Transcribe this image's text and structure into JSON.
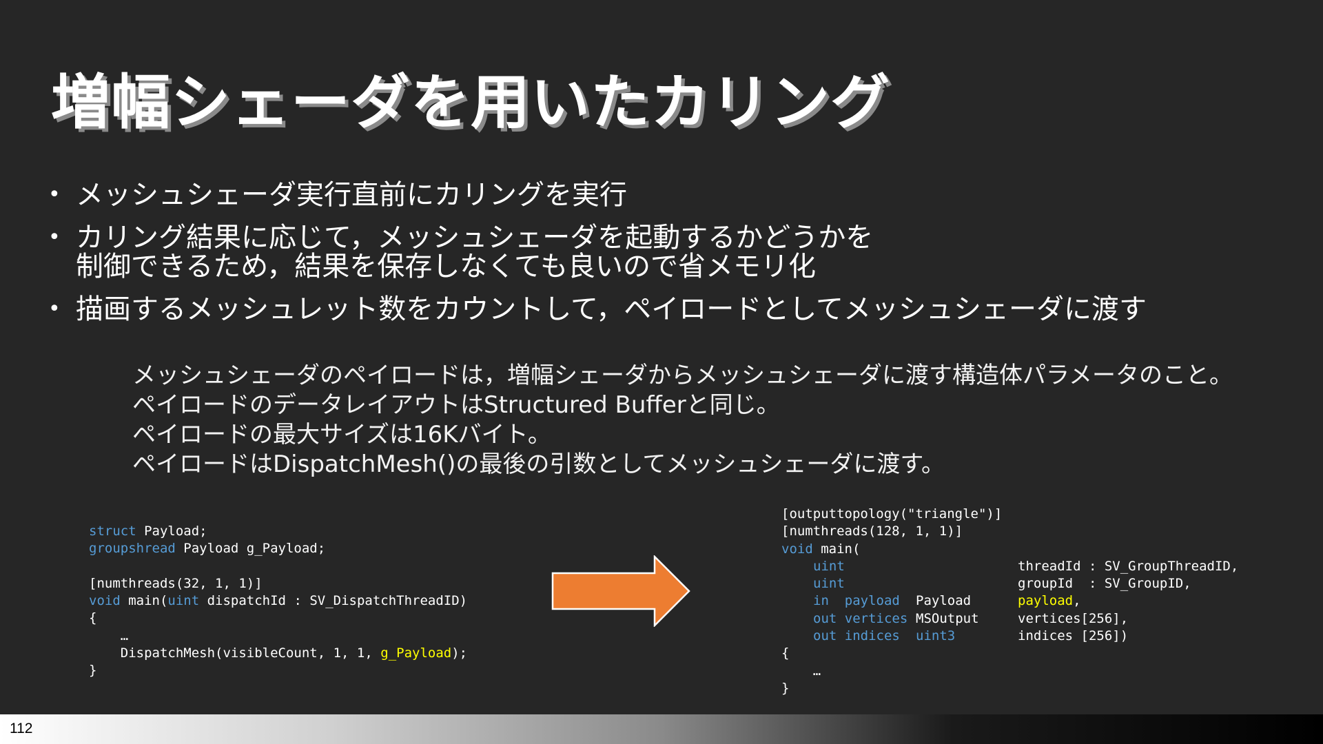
{
  "slide": {
    "title": "増幅シェーダを用いたカリング",
    "bullet_marker": "•",
    "bullets": [
      "メッシュシェーダ実行直前にカリングを実行",
      "カリング結果に応じて，メッシュシェーダを起動するかどうかを\n制御できるため，結果を保存しなくても良いので省メモリ化",
      "描画するメッシュレット数をカウントして，ペイロードとしてメッシュシェーダに渡す"
    ],
    "note_lines": [
      "メッシュシェーダのペイロードは，増幅シェーダからメッシュシェーダに渡す構造体パラメータのこと。",
      "ペイロードのデータレイアウトはStructured Bufferと同じ。",
      "ペイロードの最大サイズは16Kバイト。",
      "ペイロードはDispatchMesh()の最後の引数としてメッシュシェーダに渡す。"
    ],
    "page_number": "112"
  },
  "code_left": {
    "l1_kw": "struct",
    "l1_rest": " Payload;",
    "l2_kw": "groupshread",
    "l2_rest": " Payload g_Payload;",
    "l4": "[numthreads(32, 1, 1)]",
    "l5_kw1": "void",
    "l5_mid": " main(",
    "l5_kw2": "uint",
    "l5_rest": " dispatchId : SV_DispatchThreadID)",
    "l6": "{",
    "l7": "    …",
    "l8_pre": "    DispatchMesh(visibleCount, 1, 1, ",
    "l8_hl": "g_Payload",
    "l8_post": ");",
    "l9": "}"
  },
  "code_right": {
    "l1": "[outputtopology(\"triangle\")]",
    "l2": "[numthreads(128, 1, 1)]",
    "l3_kw": "void",
    "l3_rest": " main(",
    "l4_kw": "uint",
    "l4_rest": "threadId : SV_GroupThreadID,",
    "l5_kw": "uint",
    "l5_rest": "groupId  : SV_GroupID,",
    "l6_kw": "in  payload",
    "l6_type": "Payload",
    "l6_hl": "payload",
    "l6_post": ",",
    "l7_kw": "out vertices",
    "l7_type": "MSOutput",
    "l7_rest": "vertices[256],",
    "l8_kw": "out indices",
    "l8_kw2": "uint3",
    "l8_rest": "indices [256])",
    "l9": "{",
    "l10": "    …",
    "l11": "}"
  },
  "colors": {
    "background": "#262626",
    "keyword": "#569cd6",
    "highlight": "#ffff00",
    "arrow": "#ed7d31"
  }
}
